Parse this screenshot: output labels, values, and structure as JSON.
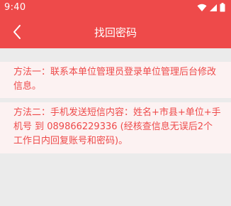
{
  "status_bar": {
    "time": "9:40",
    "icons": [
      "wifi-icon",
      "signal-icon",
      "battery-icon"
    ]
  },
  "app_bar": {
    "back_icon": "chevron-left-icon",
    "title": "找回密码"
  },
  "notices": [
    {
      "text": "方法一：联系本单位管理员登录单位管理后台修改信息。"
    },
    {
      "text": "方法二：手机发送短信内容：姓名+市县+单位+手机号 到 089866229336 (经核查信息无误后2个工作日内回复账号和密码)。"
    }
  ],
  "colors": {
    "brand_red": "#ee4a4a",
    "background": "#ebebeb",
    "notice_background": "#fcf2f2"
  }
}
